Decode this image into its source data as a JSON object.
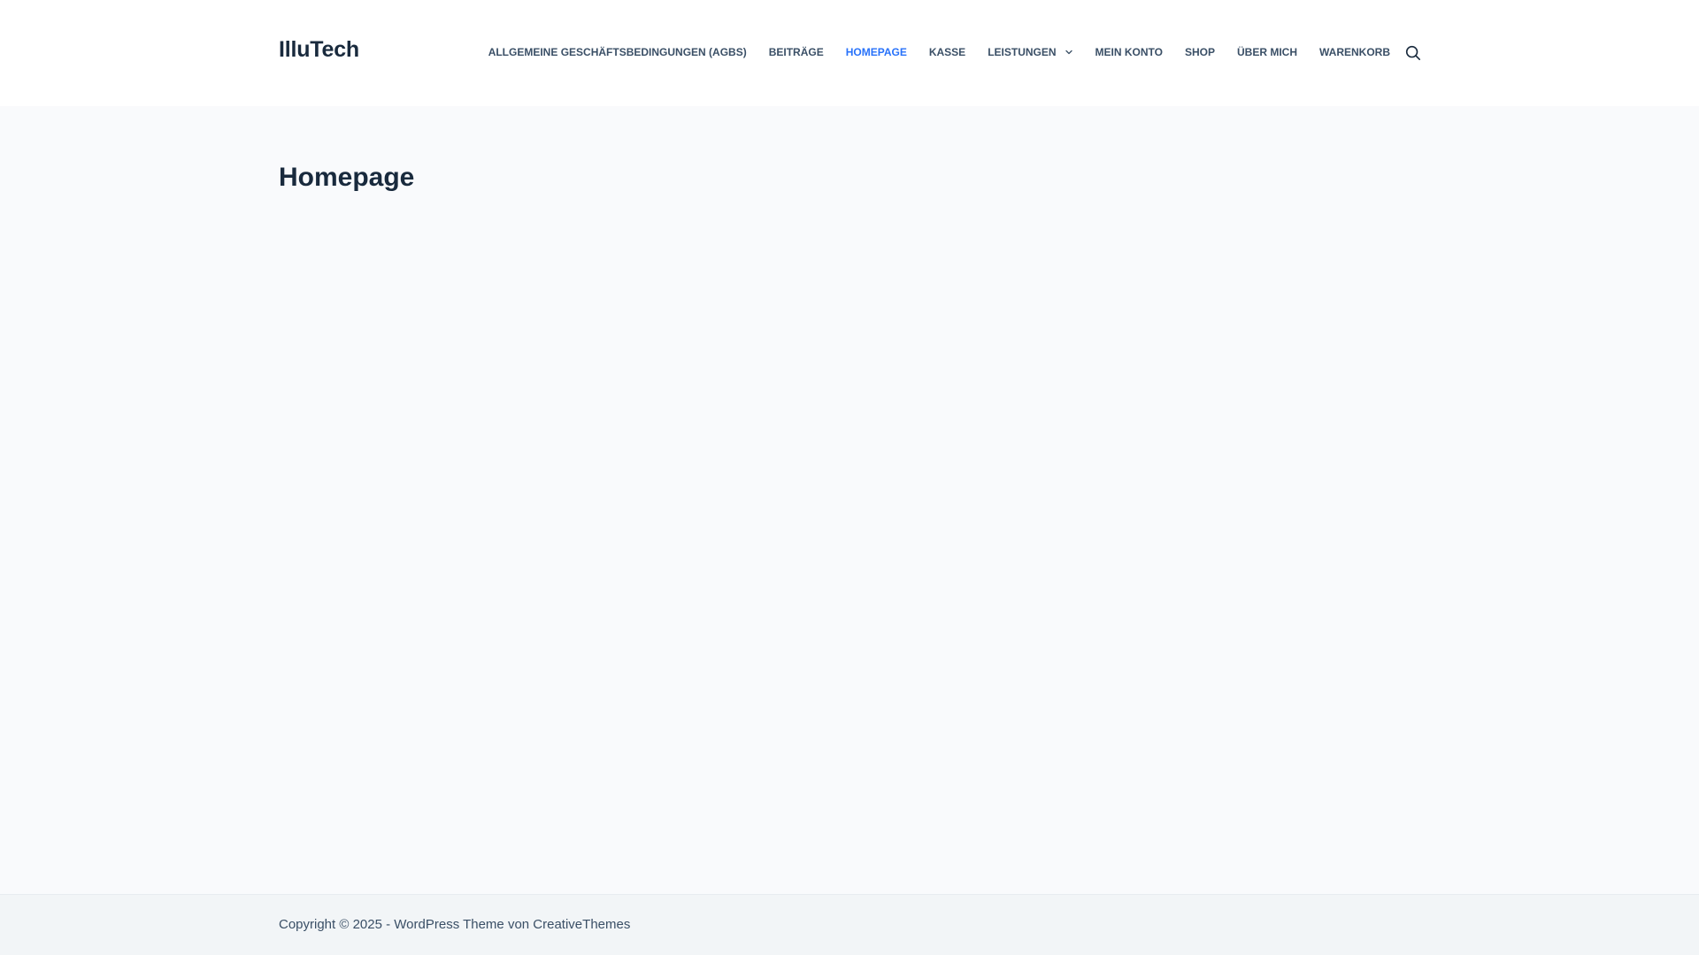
{
  "header": {
    "site_title": "IlluTech",
    "nav": {
      "items": [
        {
          "label": "Allgemeine Geschäftsbedingungen (AGBs)"
        },
        {
          "label": "Beiträge"
        },
        {
          "label": "Homepage",
          "active": true
        },
        {
          "label": "Kasse"
        },
        {
          "label": "Leistungen",
          "has_dropdown": true
        },
        {
          "label": "Mein Konto"
        },
        {
          "label": "Shop"
        },
        {
          "label": "Über mich"
        },
        {
          "label": "Warenkorb"
        }
      ]
    },
    "search_icon": "search-icon"
  },
  "main": {
    "page_title": "Homepage"
  },
  "footer": {
    "copyright_prefix": "Copyright © 2025 - WordPress Theme von ",
    "copyright_link": "CreativeThemes"
  },
  "colors": {
    "accent": "#2872fa",
    "text": "#192a3d",
    "nav_text": "#3a4f66",
    "header_bg": "#ffffff",
    "page_bg": "#f9fafc",
    "footer_bg": "#f2f5f7"
  }
}
